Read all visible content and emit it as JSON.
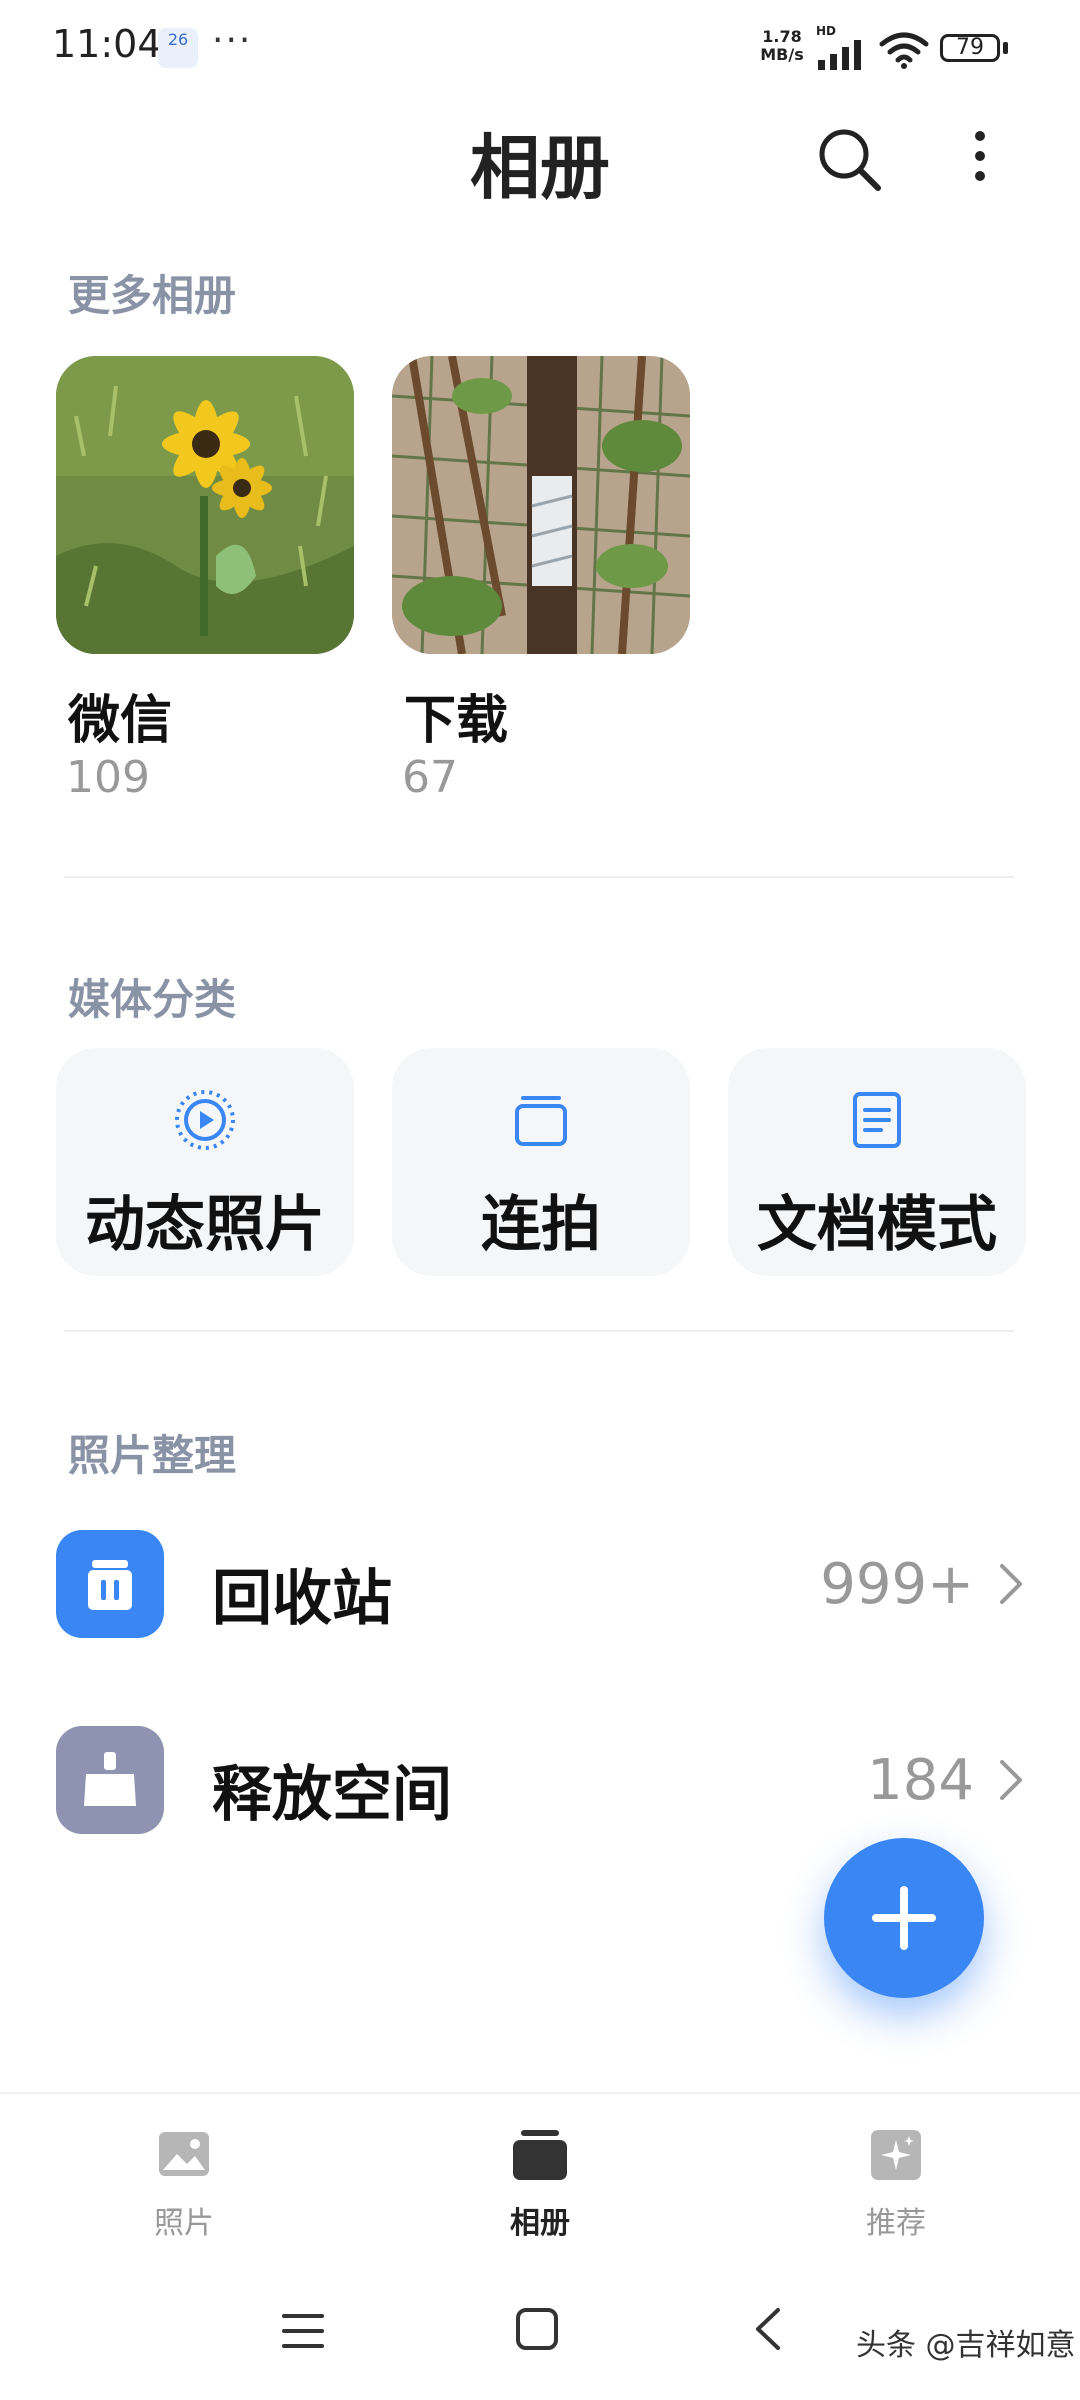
{
  "status_bar": {
    "time": "11:04",
    "calendar_day": "26",
    "more_dots": "···",
    "net_speed_value": "1.78",
    "net_speed_unit": "MB/s",
    "network": "HD",
    "battery": "79"
  },
  "header": {
    "title": "相册",
    "search_icon": "search-icon",
    "more_icon": "more-vertical-icon"
  },
  "more_albums": {
    "title": "更多相册",
    "albums": [
      {
        "name": "微信",
        "count": "109"
      },
      {
        "name": "下载",
        "count": "67"
      }
    ]
  },
  "media_types": {
    "title": "媒体分类",
    "items": [
      {
        "label": "动态照片",
        "icon": "live-photo-icon"
      },
      {
        "label": "连拍",
        "icon": "burst-icon"
      },
      {
        "label": "文档模式",
        "icon": "document-icon"
      }
    ]
  },
  "organize": {
    "title": "照片整理",
    "items": [
      {
        "label": "回收站",
        "count": "999+",
        "icon": "trash-icon",
        "color": "#3a86f4"
      },
      {
        "label": "释放空间",
        "count": "184",
        "icon": "cleanup-icon",
        "color": "#8d93b0"
      }
    ]
  },
  "fab": {
    "icon": "plus-icon",
    "color": "#3a86f4"
  },
  "bottom_nav": {
    "items": [
      {
        "label": "照片",
        "icon": "photos-icon",
        "active": false
      },
      {
        "label": "相册",
        "icon": "albums-icon",
        "active": true
      },
      {
        "label": "推荐",
        "icon": "recommend-icon",
        "active": false
      }
    ]
  },
  "watermark": "头条 @吉祥如意"
}
